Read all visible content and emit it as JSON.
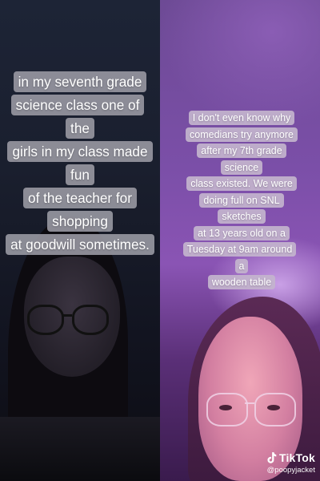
{
  "left_caption": {
    "line1": "in my seventh grade",
    "line2": "science class one of the",
    "line3": "girls in my class made fun",
    "line4": "of the teacher for shopping",
    "line5": "at goodwill sometimes."
  },
  "right_caption": {
    "line1": "I don't even know why",
    "line2": "comedians try anymore",
    "line3": "after my 7th grade science",
    "line4": "class existed. We were",
    "line5": "doing full on SNL sketches",
    "line6": "at 13 years old on a",
    "line7": "Tuesday at 9am around a",
    "line8": "wooden table"
  },
  "watermark": {
    "brand": "TikTok",
    "handle": "@poopyjacket",
    "icon": "tiktok-logo-icon"
  },
  "colors": {
    "left_background": "#161a26",
    "right_background": "#7b4fa8",
    "caption_left_bg": "#96969f",
    "caption_right_bg": "#c3b4cd"
  }
}
